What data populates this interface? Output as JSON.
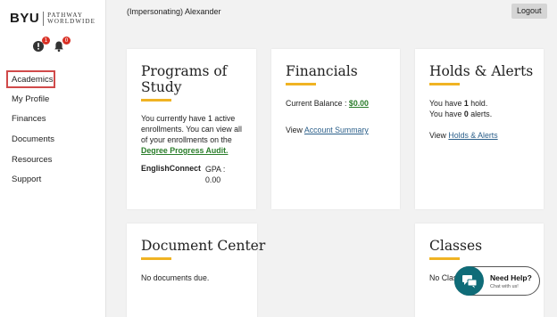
{
  "brand": {
    "name": "BYU",
    "sub1": "PATHWAY",
    "sub2": "WORLDWIDE"
  },
  "header": {
    "impersonating": "(Impersonating) Alexander",
    "logout_label": "Logout"
  },
  "icons": {
    "messages_count": "1",
    "notifications_count": "0"
  },
  "sidebar": {
    "items": [
      {
        "label": "Academics"
      },
      {
        "label": "My Profile"
      },
      {
        "label": "Finances"
      },
      {
        "label": "Documents"
      },
      {
        "label": "Resources"
      },
      {
        "label": "Support"
      }
    ]
  },
  "programs": {
    "title": "Programs of Study",
    "text": "You currently have 1 active enrollments. You can view all of your enrollments on the",
    "link": "Degree Progress Audit.",
    "enrollment_name": "EnglishConnect",
    "gpa_label": "GPA :",
    "gpa_value": "0.00"
  },
  "financials": {
    "title": "Financials",
    "balance_label": "Current Balance :",
    "balance_value": "$0.00",
    "view_label": "View",
    "view_link": "Account Summary"
  },
  "holds": {
    "title": "Holds & Alerts",
    "holds_prefix": "You have",
    "holds_count": "1",
    "holds_suffix": "hold.",
    "alerts_prefix": "You have",
    "alerts_count": "0",
    "alerts_suffix": "alerts.",
    "view_label": "View",
    "view_link": "Holds & Alerts"
  },
  "documents": {
    "title": "Document Center",
    "text": "No documents due."
  },
  "classes": {
    "title": "Classes",
    "text": "No Clas"
  },
  "chat": {
    "title": "Need Help?",
    "subtitle": "Chat with us!"
  },
  "colors": {
    "accent": "#f0b323",
    "link_green": "#2a7d2a",
    "link_blue": "#2b5f8a",
    "chat": "#0f6c78",
    "active_border": "#d04a4a"
  }
}
